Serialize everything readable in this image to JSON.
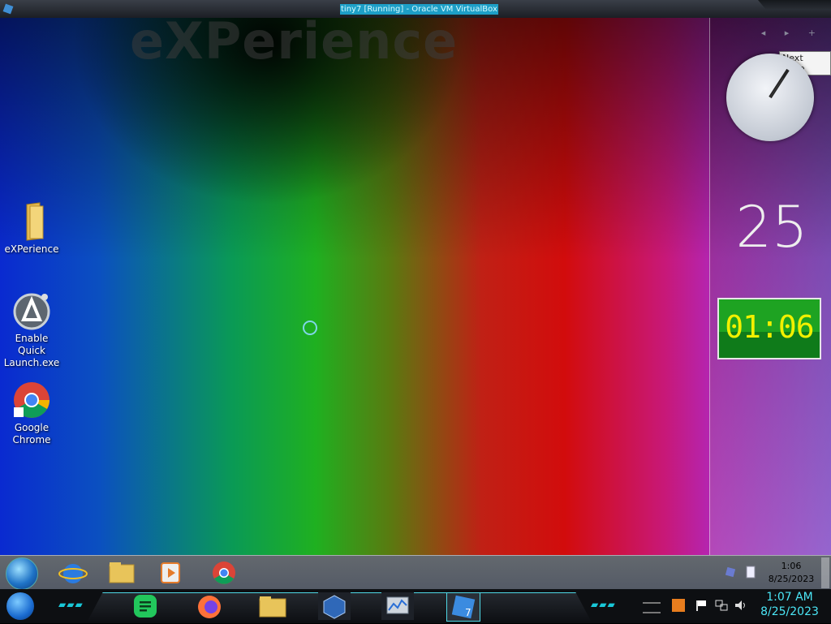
{
  "window": {
    "title": "tiny7 [Running] - Oracle VM VirtualBox"
  },
  "desktop": {
    "watermark": "eXPerience",
    "icons": [
      {
        "label": "eXPerience",
        "icon": "folder-icon"
      },
      {
        "label": "Enable Quick\nLaunch.exe",
        "icon": "app-exe-icon"
      },
      {
        "label": "Google\nChrome",
        "icon": "chrome-icon"
      }
    ]
  },
  "sidebar": {
    "tooltip": "Next page",
    "calendar_day": "25",
    "digital_clock": "01:06"
  },
  "taskbar_inner": {
    "pinned": [
      "internet-explorer-icon",
      "file-explorer-icon",
      "media-player-icon",
      "chrome-icon"
    ],
    "tray_time": "1:06",
    "tray_date": "8/25/2023"
  },
  "taskbar_host": {
    "pinned": [
      "notes-app-icon",
      "firefox-icon",
      "file-explorer-icon",
      "virtualbox-icon",
      "resource-monitor-icon",
      "windows7-vm-icon"
    ],
    "time": "1:07 AM",
    "date": "8/25/2023"
  },
  "colors": {
    "accent_cyan": "#4be6f6",
    "clock_green": "#1ea322",
    "clock_digits": "#f1f000"
  }
}
